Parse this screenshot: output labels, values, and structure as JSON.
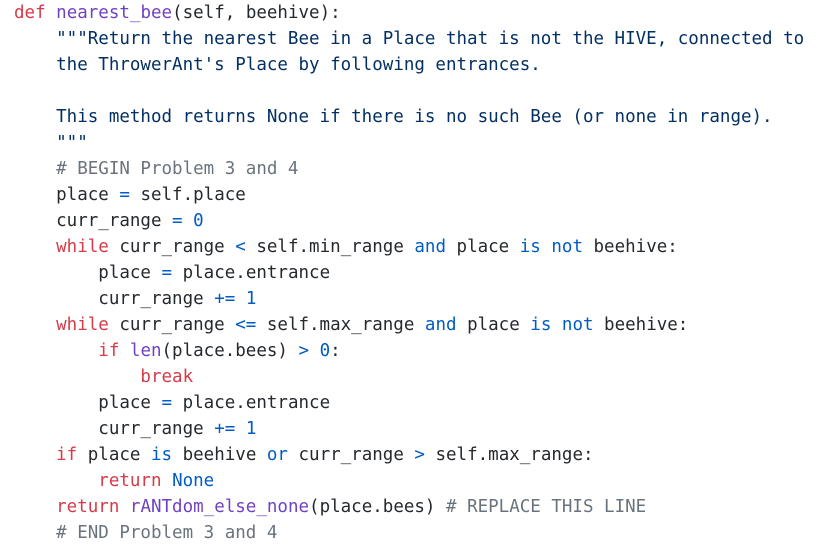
{
  "colors": {
    "keyword": "#d73a49",
    "function": "#6f42c1",
    "string": "#032f62",
    "comment": "#6a737d",
    "operator": "#005cc5",
    "number": "#005cc5",
    "constant": "#005cc5",
    "builtin": "#6f42c1",
    "identifier": "#24292e",
    "background": "#ffffff"
  },
  "code": {
    "lines": [
      [
        {
          "t": "kw",
          "v": "def"
        },
        {
          "t": "id",
          "v": " "
        },
        {
          "t": "fn",
          "v": "nearest_bee"
        },
        {
          "t": "id",
          "v": "(self, beehive):"
        }
      ],
      [
        {
          "t": "str",
          "v": "    \"\"\"Return the nearest Bee in a Place that is not the HIVE, connected to"
        }
      ],
      [
        {
          "t": "str",
          "v": "    the ThrowerAnt's Place by following entrances."
        }
      ],
      [
        {
          "t": "str",
          "v": ""
        }
      ],
      [
        {
          "t": "str",
          "v": "    This method returns None if there is no such Bee (or none in range)."
        }
      ],
      [
        {
          "t": "str",
          "v": "    \"\"\""
        }
      ],
      [
        {
          "t": "cm",
          "v": "    # BEGIN Problem 3 and 4"
        }
      ],
      [
        {
          "t": "id",
          "v": "    place "
        },
        {
          "t": "op",
          "v": "="
        },
        {
          "t": "id",
          "v": " self.place"
        }
      ],
      [
        {
          "t": "id",
          "v": "    curr_range "
        },
        {
          "t": "op",
          "v": "="
        },
        {
          "t": "id",
          "v": " "
        },
        {
          "t": "num",
          "v": "0"
        }
      ],
      [
        {
          "t": "kw",
          "v": "    while"
        },
        {
          "t": "id",
          "v": " curr_range "
        },
        {
          "t": "op",
          "v": "<"
        },
        {
          "t": "id",
          "v": " self.min_range "
        },
        {
          "t": "op",
          "v": "and"
        },
        {
          "t": "id",
          "v": " place "
        },
        {
          "t": "op",
          "v": "is not"
        },
        {
          "t": "id",
          "v": " beehive:"
        }
      ],
      [
        {
          "t": "id",
          "v": "        place "
        },
        {
          "t": "op",
          "v": "="
        },
        {
          "t": "id",
          "v": " place.entrance"
        }
      ],
      [
        {
          "t": "id",
          "v": "        curr_range "
        },
        {
          "t": "op",
          "v": "+="
        },
        {
          "t": "id",
          "v": " "
        },
        {
          "t": "num",
          "v": "1"
        }
      ],
      [
        {
          "t": "kw",
          "v": "    while"
        },
        {
          "t": "id",
          "v": " curr_range "
        },
        {
          "t": "op",
          "v": "<="
        },
        {
          "t": "id",
          "v": " self.max_range "
        },
        {
          "t": "op",
          "v": "and"
        },
        {
          "t": "id",
          "v": " place "
        },
        {
          "t": "op",
          "v": "is not"
        },
        {
          "t": "id",
          "v": " beehive:"
        }
      ],
      [
        {
          "t": "kw",
          "v": "        if"
        },
        {
          "t": "id",
          "v": " "
        },
        {
          "t": "bi",
          "v": "len"
        },
        {
          "t": "id",
          "v": "(place.bees) "
        },
        {
          "t": "op",
          "v": ">"
        },
        {
          "t": "id",
          "v": " "
        },
        {
          "t": "num",
          "v": "0"
        },
        {
          "t": "id",
          "v": ":"
        }
      ],
      [
        {
          "t": "kw",
          "v": "            break"
        }
      ],
      [
        {
          "t": "id",
          "v": "        place "
        },
        {
          "t": "op",
          "v": "="
        },
        {
          "t": "id",
          "v": " place.entrance"
        }
      ],
      [
        {
          "t": "id",
          "v": "        curr_range "
        },
        {
          "t": "op",
          "v": "+="
        },
        {
          "t": "id",
          "v": " "
        },
        {
          "t": "num",
          "v": "1"
        }
      ],
      [
        {
          "t": "kw",
          "v": "    if"
        },
        {
          "t": "id",
          "v": " place "
        },
        {
          "t": "op",
          "v": "is"
        },
        {
          "t": "id",
          "v": " beehive "
        },
        {
          "t": "op",
          "v": "or"
        },
        {
          "t": "id",
          "v": " curr_range "
        },
        {
          "t": "op",
          "v": ">"
        },
        {
          "t": "id",
          "v": " self.max_range:"
        }
      ],
      [
        {
          "t": "kw",
          "v": "        return"
        },
        {
          "t": "id",
          "v": " "
        },
        {
          "t": "const",
          "v": "None"
        }
      ],
      [
        {
          "t": "kw",
          "v": "    return"
        },
        {
          "t": "id",
          "v": " "
        },
        {
          "t": "fn",
          "v": "rANTdom_else_none"
        },
        {
          "t": "id",
          "v": "(place.bees) "
        },
        {
          "t": "cm",
          "v": "# REPLACE THIS LINE"
        }
      ],
      [
        {
          "t": "cm",
          "v": "    # END Problem 3 and 4"
        }
      ]
    ]
  }
}
